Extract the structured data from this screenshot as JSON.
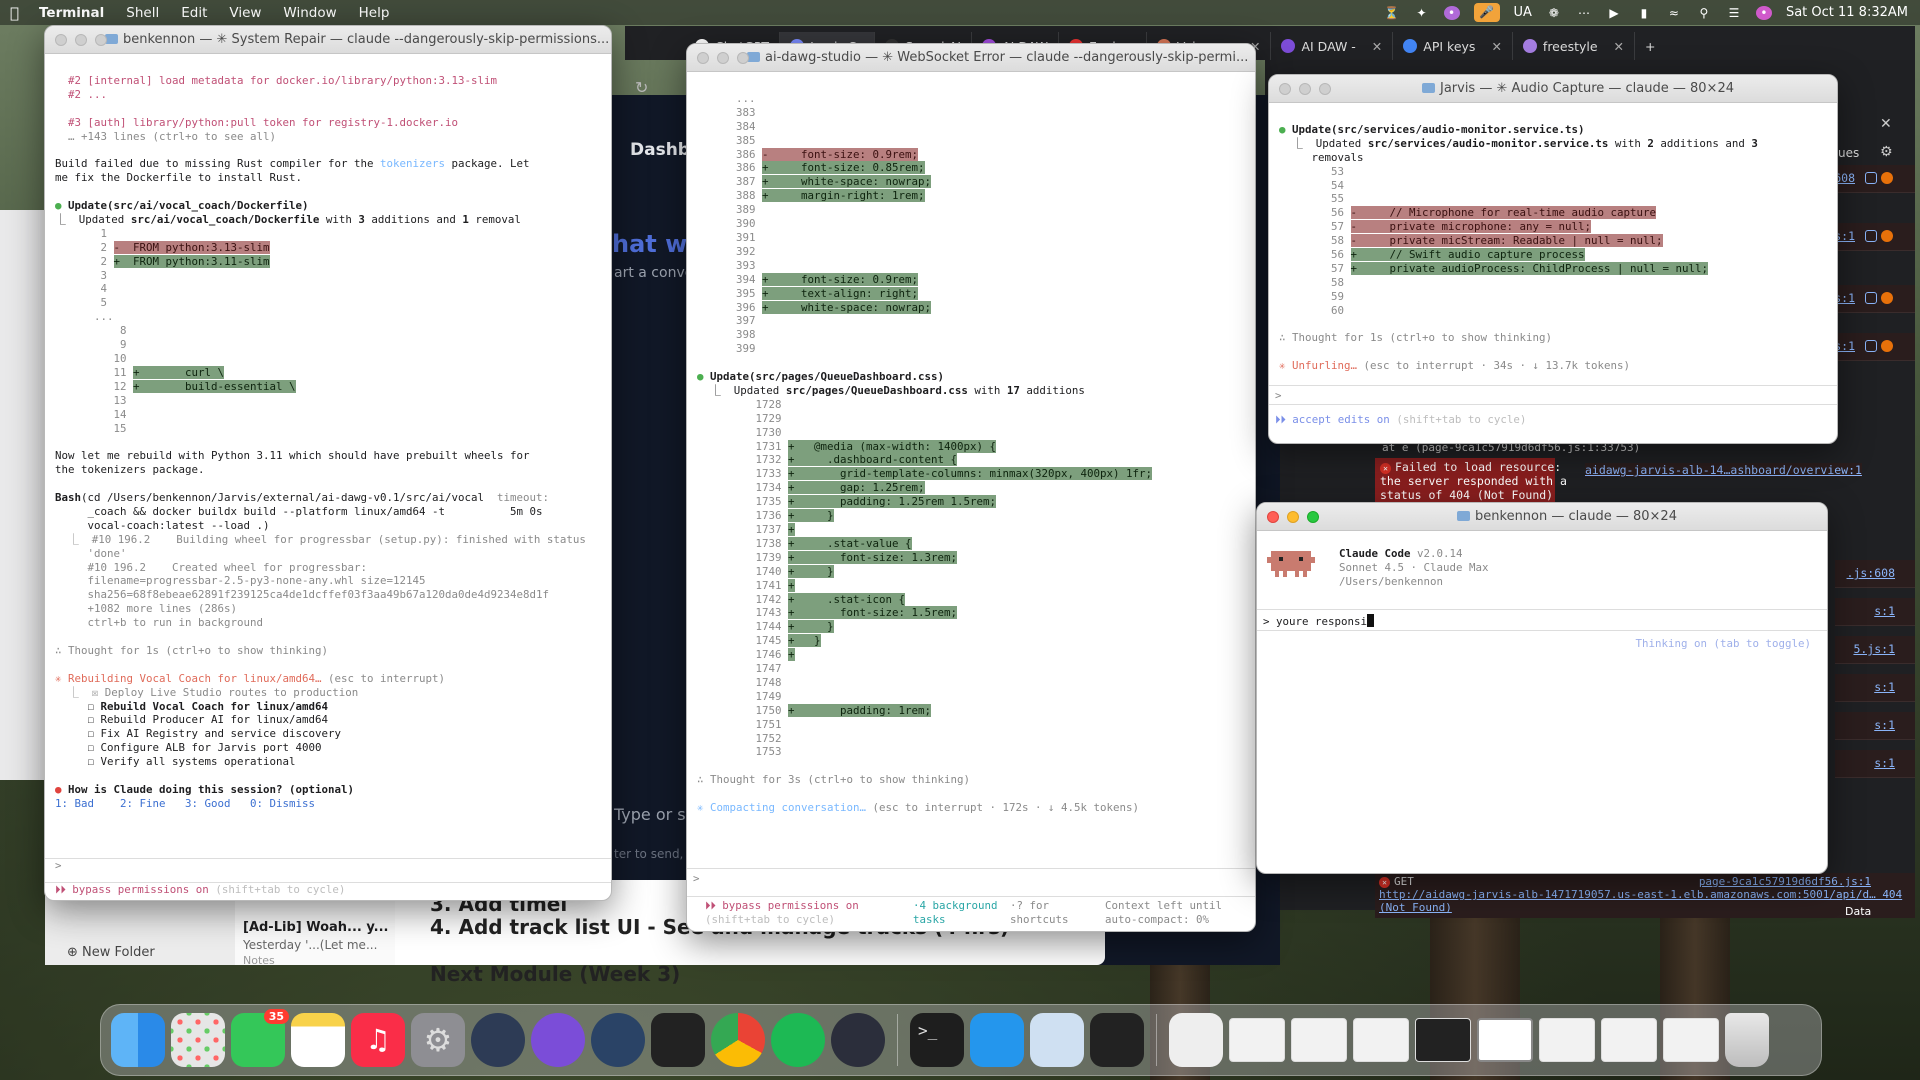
{
  "menubar": {
    "apps": [
      "Terminal",
      "Shell",
      "Edit",
      "View",
      "Window",
      "Help"
    ],
    "input_source": "UA",
    "datetime": "Sat Oct 11  8:32AM"
  },
  "chrome": {
    "tabs": [
      "ChatGPT",
      "Jarvis Co",
      "Suno | AI",
      "AI DAW",
      "Explore",
      "Voice me",
      "AI DAW -",
      "API keys",
      "freestyle"
    ]
  },
  "webapp": {
    "dashboard": "Dashbo",
    "heading": "hat wit",
    "subtitle": "art a conver",
    "type": "Type or sp",
    "enter": "ter to send, S"
  },
  "notes": {
    "line3": "3. Add timel",
    "line4": "4. Add track list UI - See and manage tracks (4 hrs)",
    "next": "Next Module (Week 3)",
    "item_title": "[Ad-Lib] Woah... y...",
    "item_sub": "Yesterday  '...(Let me...",
    "item_folder": "Notes",
    "new_folder": "New Folder"
  },
  "errors": {
    "e1": "Failed to load resource: the server responded with a status of 404 (Not Found)",
    "at": "at e (page-9ca1c57919d6df56.js:1:33753)",
    "link1": "aidawg-jarvis-alb-14…ashboard/overview:1",
    "get": "GET",
    "get_link": "http://aidawg-jarvis-alb-1471719057.us-east-1.elb.amazonaws.com:5001/api/d… 404 (Not Found)",
    "page_link": "page-9ca1c57919d6df56.js:1",
    "issues": "ues",
    "data": "Data"
  },
  "term1": {
    "title": "benkennon — ✳ System Repair — claude --dangerously-skip-permissions...",
    "l1": "#2 [internal] load metadata for docker.io/library/python:3.13-slim",
    "l2": "#2 ...",
    "l3": "#3 [auth] library/python:pull token for registry-1.docker.io",
    "l4": "… +143 lines (ctrl+o to see all)",
    "l5a": "Build failed due to missing Rust compiler for the ",
    "l5b": "tokenizers",
    "l5c": " package. Let",
    "l6": "me fix the Dockerfile to install Rust.",
    "u1": "Update(src/ai/vocal_coach/Dockerfile)",
    "u2a": "⎿  Updated ",
    "u2b": "src/ai/vocal_coach/Dockerfile",
    "u2c": " with ",
    "u2d": "3",
    "u2e": " additions and ",
    "u2f": "1",
    "u2g": " removal",
    "d1": "       1",
    "d2n": "       2",
    "d2": "-  FROM python:3.13-slim",
    "d3n": "       2",
    "d3": "+  FROM python:3.11-slim",
    "d4": "       3",
    "d5": "       4",
    "d6": "       5",
    "d7": "      ...",
    "d8": "          8",
    "d9": "          9",
    "d10": "         10",
    "d11n": "         11",
    "d11": "+       curl \\",
    "d12n": "         12",
    "d12": "+       build-essential \\",
    "d13": "         13",
    "d14": "         14",
    "d15": "         15",
    "n1": "Now let me rebuild with Python 3.11 which should have prebuilt wheels for",
    "n2": "the tokenizers package.",
    "b1a": "Bash",
    "b1b": "(cd /Users/benkennon/Jarvis/external/ai-dawg-v0.1/src/ai/vocal",
    "b1c": "  timeout:",
    "b2": "     _coach && docker buildx build --platform linux/amd64 -t          5m 0s",
    "b3": "     vocal-coach:latest --load .)",
    "o1": "  ⎿  #10 196.2    Building wheel for progressbar (setup.py): finished with status",
    "o2": "     'done'",
    "o3": "     #10 196.2    Created wheel for progressbar:",
    "o4": "     filename=progressbar-2.5-py3-none-any.whl size=12145",
    "o5": "     sha256=68f8ebeae62891f239125ca4de1dcffef03f3aa49b67a120da0de4d9234e8d1f",
    "o6": "     +1082 more lines (286s)",
    "o7": "     ctrl+b to run in background",
    "th": "∴ Thought for 1s (ctrl+o to show thinking)",
    "rb1": "✳ Rebuilding Vocal Coach for linux/amd64…",
    "rb2": " (esc to interrupt)",
    "t1": "  ⎿  ☒ Deploy Live Studio routes to production",
    "t2": "     ☐ Rebuild Vocal Coach for linux/amd64",
    "t3": "     ☐ Rebuild Producer AI for linux/amd64",
    "t4": "     ☐ Fix AI Registry and service discovery",
    "t5": "     ☐ Configure ALB for Jarvis port 4000",
    "t6": "     ☐ Verify all systems operational",
    "q1": "How is Claude doing this session? (optional)",
    "q2": "1: Bad    2: Fine   3: Good   0: Dismiss",
    "prompt": ">",
    "bp1": "⏵⏵ bypass permissions on",
    "bp2": " (shift+tab to cycle)"
  },
  "term2": {
    "title": "ai-dawg-studio — ✳ WebSocket Error — claude --dangerously-skip-permi...",
    "top": "      ...",
    "r383": "      383",
    "r384": "      384",
    "r385": "      385",
    "r386a": "      386 ",
    "r386b": "-     font-size: 0.9rem;",
    "r386c": "      386 ",
    "r386d": "+     font-size: 0.85rem;",
    "r387a": "      387 ",
    "r387b": "+     white-space: nowrap;",
    "r388a": "      388 ",
    "r388b": "+     margin-right: 1rem;",
    "r389": "      389",
    "r390": "      390",
    "r391": "      391",
    "r392": "      392",
    "r393": "      393",
    "r394a": "      394 ",
    "r394b": "+     font-size: 0.9rem;",
    "r395a": "      395 ",
    "r395b": "+     text-align: right;",
    "r396a": "      396 ",
    "r396b": "+     white-space: nowrap;",
    "r397": "      397",
    "r398": "      398",
    "r399": "      399",
    "u1": "Update(src/pages/QueueDashboard.css)",
    "u2a": "  ⎿  Updated ",
    "u2b": "src/pages/QueueDashboard.css",
    "u2c": " with ",
    "u2d": "17",
    "u2e": " additions",
    "c1728": "         1728",
    "c1729": "         1729",
    "c1730": "         1730",
    "c1731a": "         1731 ",
    "c1731b": "+   @media (max-width: 1400px) {",
    "c1732a": "         1732 ",
    "c1732b": "+     .dashboard-content {",
    "c1733a": "         1733 ",
    "c1733b": "+       grid-template-columns: minmax(320px, 400px) 1fr;",
    "c1734a": "         1734 ",
    "c1734b": "+       gap: 1.25rem;",
    "c1735a": "         1735 ",
    "c1735b": "+       padding: 1.25rem 1.5rem;",
    "c1736a": "         1736 ",
    "c1736b": "+     }",
    "c1737a": "         1737 ",
    "c1737b": "+",
    "c1738a": "         1738 ",
    "c1738b": "+     .stat-value {",
    "c1739a": "         1739 ",
    "c1739b": "+       font-size: 1.3rem;",
    "c1740a": "         1740 ",
    "c1740b": "+     }",
    "c1741a": "         1741 ",
    "c1741b": "+",
    "c1742a": "         1742 ",
    "c1742b": "+     .stat-icon {",
    "c1743a": "         1743 ",
    "c1743b": "+       font-size: 1.5rem;",
    "c1744a": "         1744 ",
    "c1744b": "+     }",
    "c1745a": "         1745 ",
    "c1745b": "+   }",
    "c1746a": "         1746 ",
    "c1746b": "+",
    "c1747": "         1747",
    "c1748": "         1748",
    "c1749": "         1749",
    "c1750a": "         1750 ",
    "c1750b": "+       padding: 1rem;",
    "c1751": "         1751",
    "c1752": "         1752",
    "c1753": "         1753",
    "th": "∴ Thought for 3s (ctrl+o to show thinking)",
    "cp1": "✳ Compacting conversation…",
    "cp2": " (esc to interrupt · 172s · ↓ 4.5k tokens)",
    "prompt": ">",
    "s1": "⏵⏵ bypass permissions on",
    "s2": "(shift+tab to cycle)",
    "s3": "·4 background",
    "s4": "tasks",
    "s5": "·? for",
    "s6": "shortcuts",
    "s7": "Context left until",
    "s8": "auto-compact: 0%"
  },
  "term3": {
    "title": "Jarvis — ✳ Audio Capture — claude — 80×24",
    "u1": "Update(src/services/audio-monitor.service.ts)",
    "u2a": "  ⎿  Updated ",
    "u2b": "src/services/audio-monitor.service.ts",
    "u2c": " with ",
    "u2d": "2",
    "u2e": " additions and ",
    "u2f": "3",
    "u3": "     removals",
    "r53": "        53",
    "r54": "        54",
    "r55": "        55",
    "r56a": "        56 ",
    "r56b": "-     // Microphone for real-time audio capture",
    "r57a": "        57 ",
    "r57b": "-     private microphone: any = null;",
    "r58a": "        58 ",
    "r58b": "-     private micStream: Readable | null = null;",
    "r56c": "        56 ",
    "r56d": "+     // Swift audio capture process",
    "r57c": "        57 ",
    "r57d": "+     private audioProcess: ChildProcess | null = null;",
    "r58": "        58",
    "r59": "        59",
    "r60": "        60",
    "th": "∴ Thought for 1s (ctrl+o to show thinking)",
    "uf1": "✳ Unfurling…",
    "uf2": " (esc to interrupt · 34s · ↓ 13.7k tokens)",
    "prompt": ">",
    "ae1": "  ⏵⏵ accept edits on",
    "ae2": " (shift+tab to cycle)"
  },
  "term4": {
    "title": "benkennon — claude — 80×24",
    "name": "Claude Code",
    "ver": " v2.0.14",
    "model": "Sonnet 4.5 · Claude Max",
    "path": "/Users/benkennon",
    "input": "> youre responsi",
    "hint": "Thinking on (tab to toggle)"
  },
  "dock": {
    "messages_badge": "35",
    "apps": [
      "Finder",
      "Launchpad",
      "Messages",
      "Notes",
      "Music",
      "System Settings",
      "Xcode Instruments",
      "Logic Pro",
      "Atlas",
      "Ableton",
      "Chrome",
      "Spotify",
      "Electron",
      "Terminal",
      "Docker",
      "Preview",
      "Audio Recorder",
      "Music",
      "Trash"
    ]
  }
}
